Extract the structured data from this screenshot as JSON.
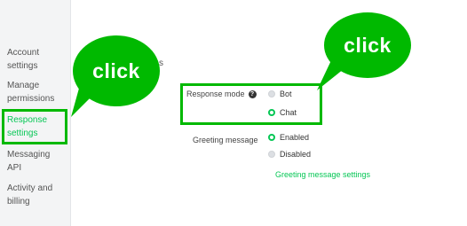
{
  "sidebar": {
    "items": [
      {
        "label": "Account settings"
      },
      {
        "label": "Manage permissions"
      },
      {
        "label": "Response settings"
      },
      {
        "label": "Messaging API"
      },
      {
        "label": "Activity and billing"
      }
    ]
  },
  "main": {
    "partial_heading": "s",
    "response_mode": {
      "label": "Response mode",
      "help_icon": "?",
      "options": [
        {
          "label": "Bot",
          "selected": false
        },
        {
          "label": "Chat",
          "selected": true
        }
      ]
    },
    "greeting_message": {
      "label": "Greeting message",
      "options": [
        {
          "label": "Enabled",
          "selected": true
        },
        {
          "label": "Disabled",
          "selected": false
        }
      ],
      "settings_link": "Greeting message settings"
    }
  },
  "annotations": {
    "left_bubble": "click",
    "right_bubble": "click"
  },
  "colors": {
    "accent": "#06c755",
    "highlight": "#00b900",
    "sidebar_bg": "#f3f4f5"
  }
}
